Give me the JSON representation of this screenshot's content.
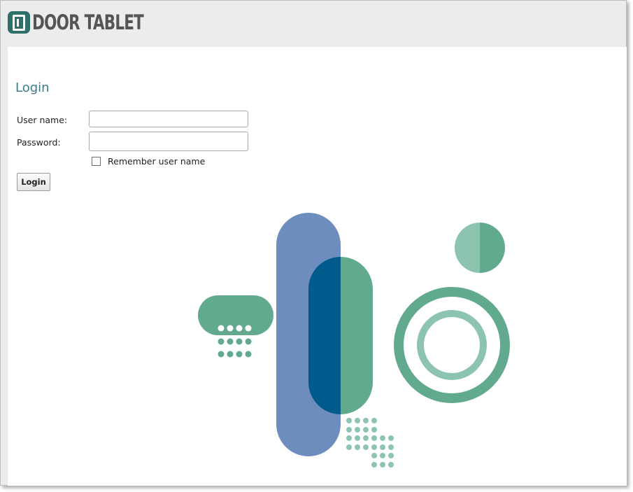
{
  "brand": {
    "name": "DOOR TABLET",
    "logo_icon": "door-tablet-logo-icon",
    "logo_color": "#2e6f6a",
    "text_color": "#555555"
  },
  "login": {
    "title": "Login",
    "username_label": "User name:",
    "username_value": "",
    "password_label": "Password:",
    "password_value": "",
    "remember_label": "Remember user name",
    "remember_checked": false,
    "submit_label": "Login"
  },
  "colors": {
    "header_bg": "#ececec",
    "title": "#3b7a8a",
    "green": "#62aa8e",
    "light_green": "#8dc4b0",
    "blue": "#6e8dbf",
    "navy": "#005a8c"
  }
}
